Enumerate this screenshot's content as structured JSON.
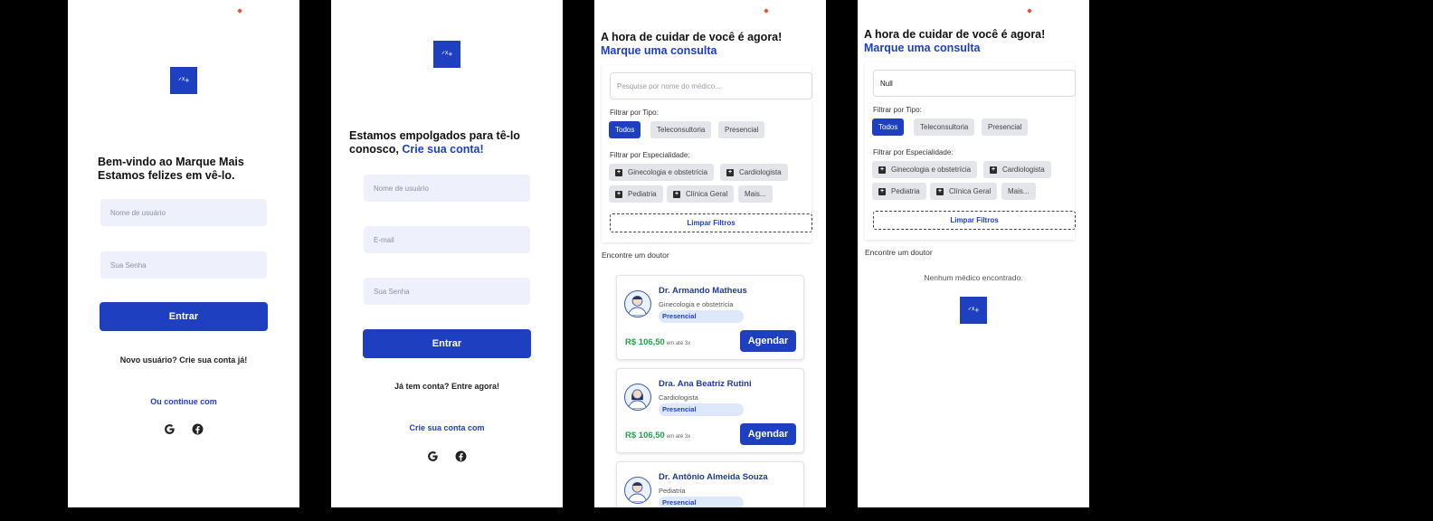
{
  "logo_text": "ᐟᕽ+",
  "login": {
    "heading_line1": "Bem-vindo ao Marque Mais",
    "heading_line2": "Estamos felizes em vê-lo.",
    "username_placeholder": "Nome de usuário",
    "password_placeholder": "Sua Senha",
    "submit_label": "Entrar",
    "new_user_text": "Novo usuário? Crie sua conta já!",
    "continue_with": "Ou continue com"
  },
  "signup": {
    "heading_line1": "Estamos empolgados para tê-lo",
    "heading_line2_plain": "conosco, ",
    "heading_line2_link": "Crie sua conta!",
    "username_placeholder": "Nome de usuário",
    "email_placeholder": "E-mail",
    "password_placeholder": "Sua Senha",
    "submit_label": "Entrar",
    "have_account_text": "Já tem conta? Entre agora!",
    "create_with": "Crie sua conta com"
  },
  "search": {
    "heading": "A hora de cuidar de você é agora!",
    "subheading": "Marque uma consulta",
    "search_placeholder": "Pesquise por nome do médico...",
    "type_label": "Filtrar por Tipo:",
    "types": [
      "Todos",
      "Teleconsultoria",
      "Presencial"
    ],
    "specialty_label": "Filtrar por Especialidade:",
    "specialties": [
      "Ginecologia e obstetrícia",
      "Cardiologista",
      "Pediatria",
      "Clínica Geral"
    ],
    "more_label": "Mais...",
    "clear_label": "Limpar Filtros",
    "find_label": "Encontre um doutor",
    "doctors": [
      {
        "name": "Dr. Armando Matheus",
        "specialty": "Ginecologia e obstetrícia",
        "badge": "Presencial",
        "price": "R$ 106,50",
        "price_note": "em até 3x",
        "button": "Agendar"
      },
      {
        "name": "Dra. Ana Beatriz Rutini",
        "specialty": "Cardiologista",
        "badge": "Presencial",
        "price": "R$ 106,50",
        "price_note": "em até 3x",
        "button": "Agendar"
      },
      {
        "name": "Dr. Antônio Almeida Souza",
        "specialty": "Pediatria",
        "badge": "Presencial",
        "price": "",
        "price_note": "",
        "button": ""
      }
    ]
  },
  "search_empty": {
    "heading": "A hora de cuidar de você é agora!",
    "subheading": "Marque uma consulta",
    "search_value": "Null",
    "type_label": "Filtrar por Tipo:",
    "types": [
      "Todos",
      "Teleconsultoria",
      "Presencial"
    ],
    "specialty_label": "Filtrar por Especialidade:",
    "specialties": [
      "Ginecologia e obstetrícia",
      "Cardiologista",
      "Pediatria",
      "Clínica Geral"
    ],
    "more_label": "Mais...",
    "clear_label": "Limpar Filtros",
    "find_label": "Encontre um doutor",
    "empty_message": "Nenhum médico encontrado."
  },
  "colors": {
    "primary": "#1e40c0",
    "price": "#1fa64a",
    "accent_dot": "#e8542f"
  }
}
